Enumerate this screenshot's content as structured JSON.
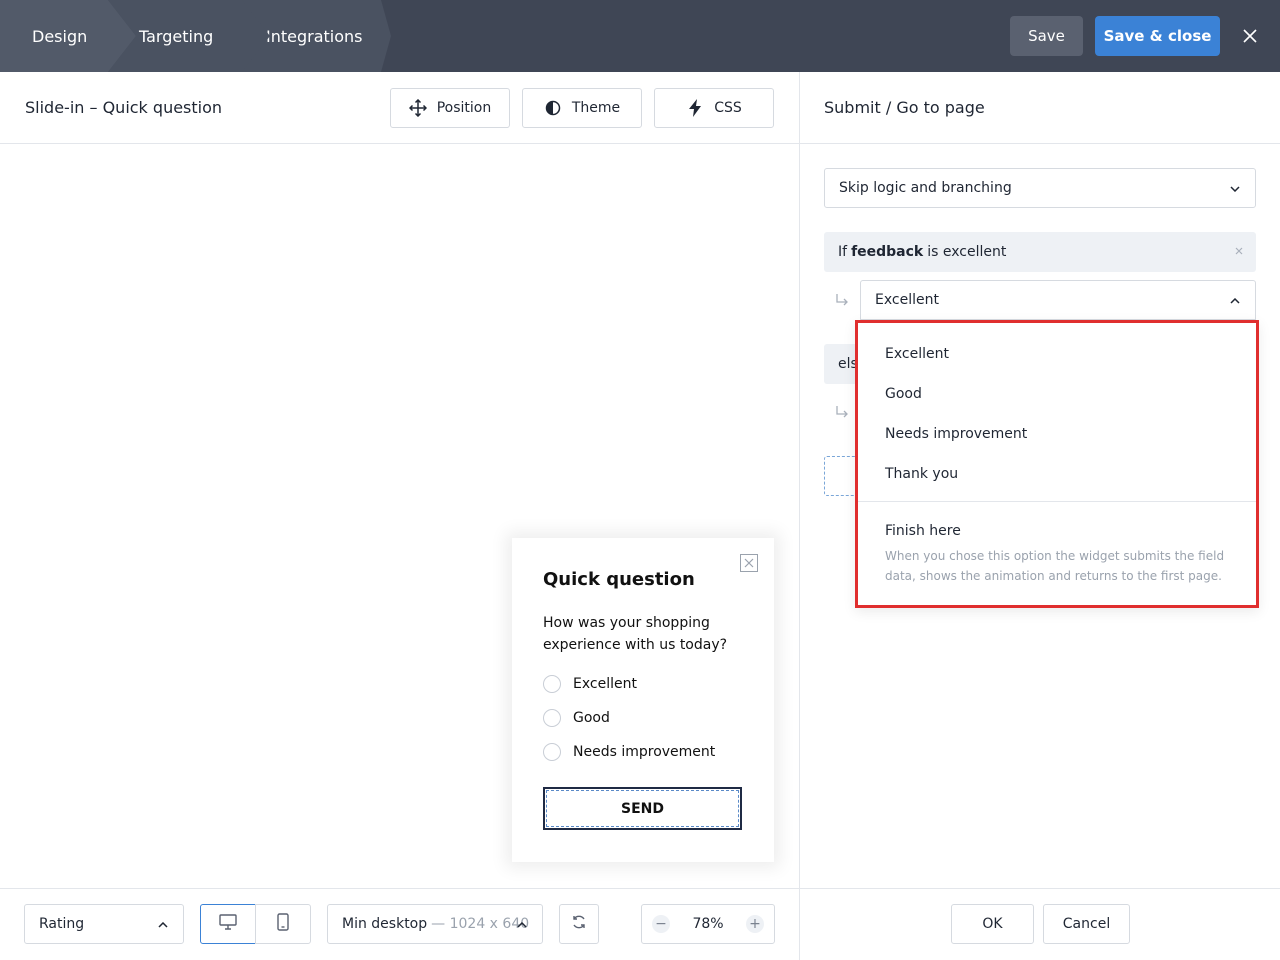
{
  "topbar": {
    "tabs": [
      "Design",
      "Targeting",
      "Integrations"
    ],
    "save_label": "Save",
    "save_close_label": "Save & close"
  },
  "editor": {
    "page_title": "Slide-in – Quick question",
    "position_label": "Position",
    "theme_label": "Theme",
    "css_label": "CSS"
  },
  "panel": {
    "title": "Submit / Go to page",
    "skip_logic_label": "Skip logic and branching",
    "condition": {
      "prefix": "If",
      "field": "feedback",
      "suffix": "is excellent"
    },
    "selected_target": "Excellent",
    "else_label": "else"
  },
  "dropdown": {
    "options": [
      "Excellent",
      "Good",
      "Needs improvement",
      "Thank you"
    ],
    "finish_label": "Finish here",
    "finish_desc": "When you chose this option the widget submits the field data, shows the animation and returns to the first page."
  },
  "widget": {
    "title": "Quick question",
    "question": "How was your shopping experience with us today?",
    "options": [
      "Excellent",
      "Good",
      "Needs improvement"
    ],
    "send_label": "SEND"
  },
  "bottombar": {
    "field_type": "Rating",
    "resolution_label": "Min desktop",
    "resolution_dims": "— 1024 x 640",
    "zoom": "78%",
    "ok_label": "OK",
    "cancel_label": "Cancel"
  },
  "icons": {
    "close": "close-icon",
    "position": "move-icon",
    "theme": "contrast-icon",
    "css": "lightning-icon",
    "desktop": "monitor-icon",
    "mobile": "phone-icon",
    "refresh": "rotate-icon"
  },
  "colors": {
    "topbar": "#3f4655",
    "accent": "#3b82d6",
    "highlight": "#e02e2e"
  }
}
